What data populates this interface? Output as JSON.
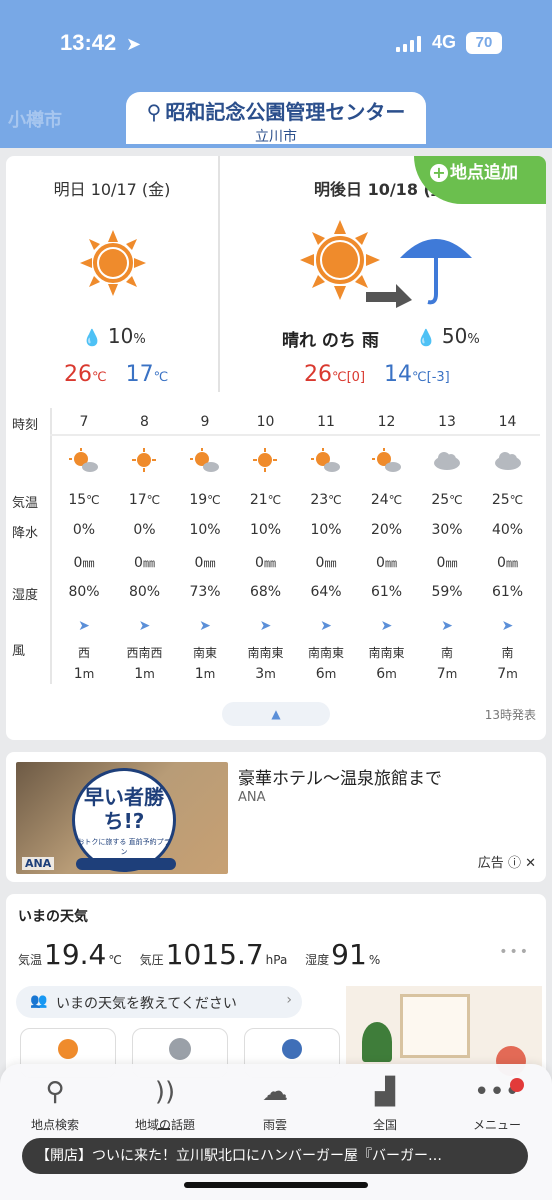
{
  "status_bar": {
    "time": "13:42",
    "network": "4G",
    "battery": "70"
  },
  "header": {
    "ghost_city": "小樽市",
    "location": "昭和記念公園管理センター",
    "city": "立川市"
  },
  "add_location_label": "地点追加",
  "days": [
    {
      "title": "明日 10/17 (金)",
      "precip": "10",
      "precip_unit": "%",
      "high": "26",
      "low": "17",
      "unit": "℃"
    },
    {
      "title": "明後日 10/18 (土)",
      "description": "晴れ のち 雨",
      "precip": "50",
      "precip_unit": "%",
      "high": "26",
      "high_diff": "[0]",
      "low": "14",
      "low_diff": "[-3]",
      "unit": "℃"
    }
  ],
  "hourly_labels": {
    "time": "時刻",
    "temp": "気温",
    "precip": "降水",
    "humidity": "湿度",
    "wind": "風"
  },
  "hourly": [
    {
      "hour": "7",
      "icon": "sun-cloud-icon",
      "temp": "15",
      "chance": "0%",
      "amount": "0",
      "humidity": "80%",
      "dir": "西",
      "speed": "1"
    },
    {
      "hour": "8",
      "icon": "sun-icon",
      "temp": "17",
      "chance": "0%",
      "amount": "0",
      "humidity": "80%",
      "dir": "西南西",
      "speed": "1"
    },
    {
      "hour": "9",
      "icon": "sun-cloud-icon",
      "temp": "19",
      "chance": "10%",
      "amount": "0",
      "humidity": "73%",
      "dir": "南東",
      "speed": "1"
    },
    {
      "hour": "10",
      "icon": "sun-icon",
      "temp": "21",
      "chance": "10%",
      "amount": "0",
      "humidity": "68%",
      "dir": "南南東",
      "speed": "3"
    },
    {
      "hour": "11",
      "icon": "sun-cloud-icon",
      "temp": "23",
      "chance": "10%",
      "amount": "0",
      "humidity": "64%",
      "dir": "南南東",
      "speed": "6"
    },
    {
      "hour": "12",
      "icon": "sun-cloud-icon",
      "temp": "24",
      "chance": "20%",
      "amount": "0",
      "humidity": "61%",
      "dir": "南南東",
      "speed": "6"
    },
    {
      "hour": "13",
      "icon": "cloud-icon",
      "temp": "25",
      "chance": "30%",
      "amount": "0",
      "humidity": "59%",
      "dir": "南",
      "speed": "7"
    },
    {
      "hour": "14",
      "icon": "cloud-icon",
      "temp": "25",
      "chance": "40%",
      "amount": "0",
      "humidity": "61%",
      "dir": "南",
      "speed": "7"
    }
  ],
  "units": {
    "temp": "℃",
    "amount": "㎜",
    "speed": "m"
  },
  "issued": "13時発表",
  "ad": {
    "title": "豪華ホテル～温泉旅館まで",
    "source": "ANA",
    "label": "広告",
    "image_heading": "早い者勝ち!?",
    "image_sub": "おトクに旅する 直前予約プラン",
    "image_brand": "ANA"
  },
  "now": {
    "title": "いまの天気",
    "temp_label": "気温",
    "temp": "19.4",
    "temp_unit": "℃",
    "pressure_label": "気圧",
    "pressure": "1015.7",
    "pressure_unit": "hPa",
    "humidity_label": "湿度",
    "humidity": "91",
    "humidity_unit": "%",
    "tell_label": "いまの天気を教えてください"
  },
  "tabs": [
    {
      "label": "地点検索",
      "icon": "search-icon"
    },
    {
      "label": "地域の話題",
      "icon": "feed-icon"
    },
    {
      "label": "雨雲",
      "icon": "rain-cloud-icon"
    },
    {
      "label": "全国",
      "icon": "map-icon"
    },
    {
      "label": "メニュー",
      "icon": "menu-dots-icon"
    }
  ],
  "toast": "【開店】ついに来た！立川駅北口にハンバーガー屋『バーガー…"
}
